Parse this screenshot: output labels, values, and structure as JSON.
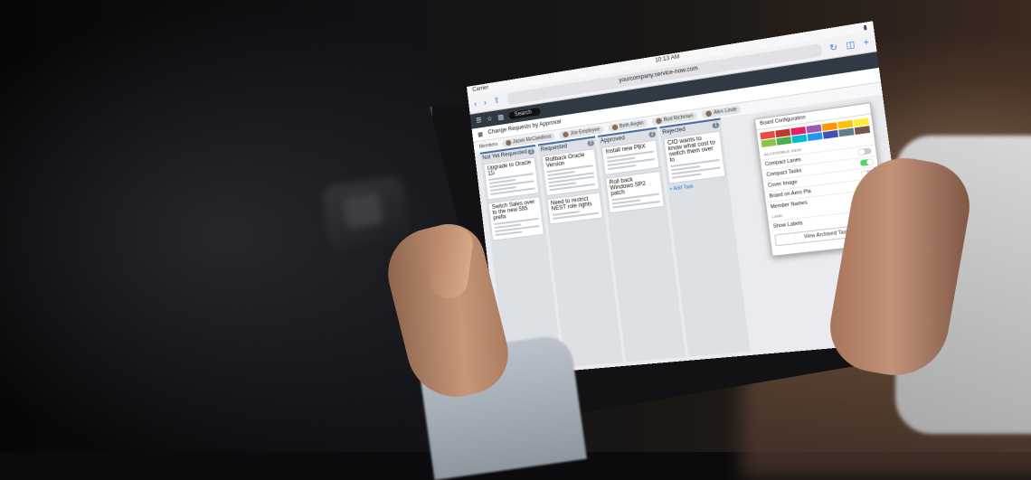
{
  "status": {
    "carrier": "Carrier",
    "time": "10:13 AM"
  },
  "browser": {
    "back": "‹",
    "forward": "›",
    "url": "yourcompany.service-now.com",
    "reload": "↻"
  },
  "app": {
    "search_placeholder": "Search",
    "board_title": "Change Requests by Approval",
    "members_label": "Members",
    "members": [
      "Jason McCandless",
      "Joe Employee",
      "Beth Anglin",
      "Bud Richman",
      "Alex Linde"
    ]
  },
  "lanes": [
    {
      "title": "Not Yet Requested",
      "count": "2",
      "cards": [
        {
          "title": "Upgrade to Oracle 11i"
        },
        {
          "title": "Switch Sales over to the new 555 prefix"
        }
      ]
    },
    {
      "title": "Requested",
      "count": "2",
      "cards": [
        {
          "title": "Rollback Oracle Version"
        },
        {
          "title": "Need to restrict NEST role rights"
        }
      ]
    },
    {
      "title": "Approved",
      "count": "2",
      "cards": [
        {
          "title": "Install new PBX"
        },
        {
          "title": "Roll back Windows SP2 patch"
        }
      ]
    },
    {
      "title": "Rejected",
      "count": "1",
      "cards": [
        {
          "title": "CIO wants to know what cost to switch them over to"
        }
      ]
    }
  ],
  "add_task_label": "+ Add Task",
  "popover": {
    "header": "Board Configuration",
    "swatch_colors": [
      "#e74c3c",
      "#c0392b",
      "#e91e63",
      "#9b59b6",
      "#ff9800",
      "#ffc107",
      "#ffeb3b",
      "#8bc34a",
      "#4caf50",
      "#00bcd4",
      "#2196f3",
      "#3f51b5",
      "#607d8b",
      "#795548"
    ],
    "section_label": "ACCESSIBLE VIEW",
    "rows": [
      {
        "label": "Compact Lanes",
        "on": false
      },
      {
        "label": "Compact Tasks",
        "on": true
      },
      {
        "label": "Cover Image",
        "on": false
      },
      {
        "label": "Board on Aero Pla",
        "on": true
      },
      {
        "label": "Member Names",
        "on": false
      }
    ],
    "lane_label": "LANE",
    "lane_row": "Show Labels",
    "archive_button": "View Archived Tasks"
  }
}
